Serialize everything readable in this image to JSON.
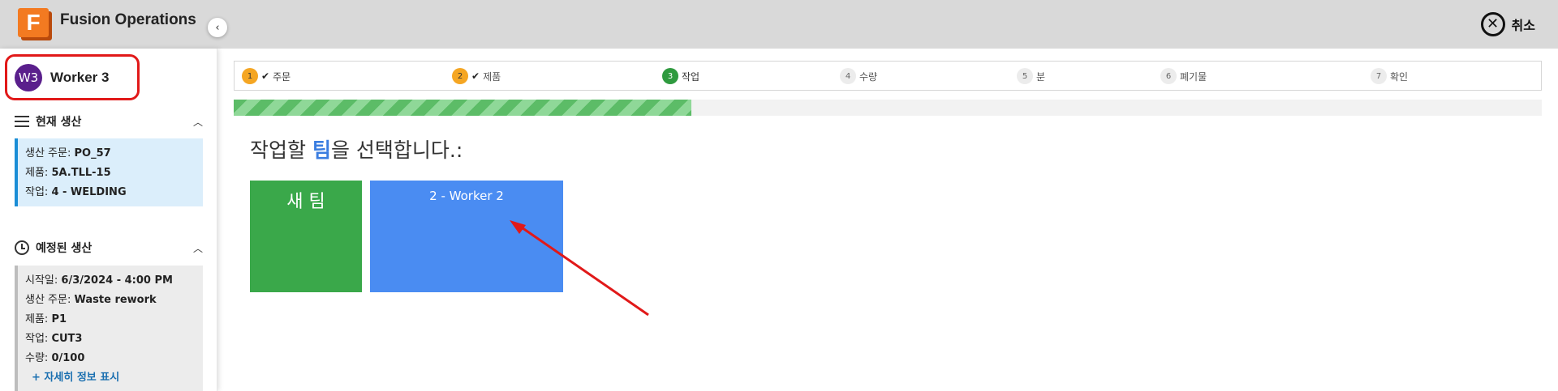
{
  "app": {
    "logo_letter": "F",
    "title": "Fusion Operations",
    "cancel_label": "취소"
  },
  "user": {
    "initials": "W3",
    "name": "Worker 3"
  },
  "sidebar": {
    "current": {
      "title": "현재 생산",
      "rows": [
        {
          "label": "생산 주문: ",
          "value": "PO_57"
        },
        {
          "label": "제품: ",
          "value": "5A.TLL-15"
        },
        {
          "label": "작업: ",
          "value": "4 - WELDING"
        }
      ]
    },
    "planned": {
      "title": "예정된 생산",
      "rows": [
        {
          "label": "시작일: ",
          "value": "6/3/2024 - 4:00 PM"
        },
        {
          "label": "생산 주문: ",
          "value": "Waste rework"
        },
        {
          "label": "제품: ",
          "value": "P1"
        },
        {
          "label": "작업: ",
          "value": "CUT3"
        },
        {
          "label": "수량: ",
          "value": "0/100"
        }
      ],
      "more_label": "+ 자세히 정보 표시"
    }
  },
  "steps": [
    {
      "num": "1",
      "label": "주문",
      "done": true,
      "state": "done"
    },
    {
      "num": "2",
      "label": "제품",
      "done": true,
      "state": "done"
    },
    {
      "num": "3",
      "label": "작업",
      "done": false,
      "state": "current"
    },
    {
      "num": "4",
      "label": "수량",
      "done": false,
      "state": "todo"
    },
    {
      "num": "5",
      "label": "분",
      "done": false,
      "state": "todo"
    },
    {
      "num": "6",
      "label": "폐기물",
      "done": false,
      "state": "todo"
    },
    {
      "num": "7",
      "label": "확인",
      "done": false,
      "state": "todo"
    }
  ],
  "progress_fraction": 0.35,
  "prompt": {
    "before": "작업할 ",
    "highlight": "팀",
    "after": "을 선택합니다.:"
  },
  "teams": [
    {
      "label": "새 팀",
      "color": "#3aa84a"
    },
    {
      "label": "2 - Worker 2",
      "color": "#4a8cf2"
    }
  ],
  "colors": {
    "accent_green": "#3aa84a",
    "accent_blue": "#4a8cf2",
    "step_orange": "#f5a623",
    "annotation_red": "#e11919"
  }
}
